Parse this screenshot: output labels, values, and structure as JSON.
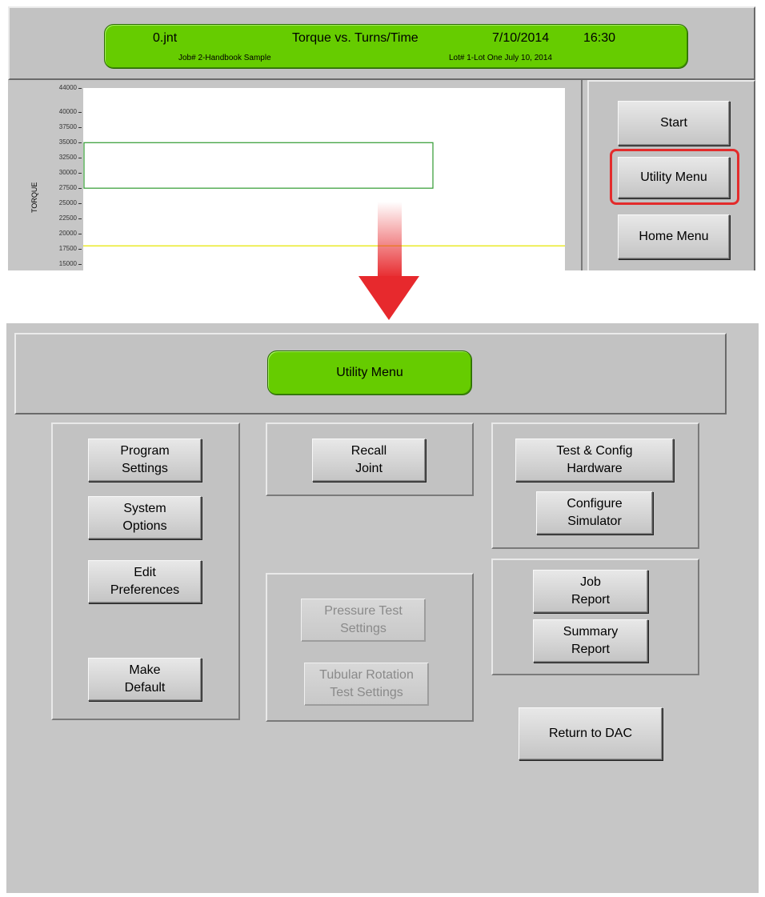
{
  "top_screen": {
    "header": {
      "file": "0.jnt",
      "title": "Torque vs. Turns/Time",
      "date": "7/10/2014",
      "time": "16:30",
      "job": "Job# 2-Handbook Sample",
      "lot": "Lot# 1-Lot One July 10, 2014",
      "color": "#66cc00"
    },
    "buttons": {
      "start": "Start",
      "utility_menu": "Utility Menu",
      "home_menu": "Home Menu"
    },
    "highlight_color": "#e32b2b",
    "chart_data": {
      "type": "line",
      "ylabel": "TORQUE",
      "y_ticks": [
        "44000",
        "40000",
        "37500",
        "35000",
        "32500",
        "30000",
        "27500",
        "25000",
        "22500",
        "20000",
        "17500",
        "15000"
      ],
      "tick_values": [
        44000,
        40000,
        37500,
        35000,
        32500,
        30000,
        27500,
        25000,
        22500,
        20000,
        17500,
        15000
      ],
      "target_box": {
        "y_min": 27500,
        "y_max": 35000,
        "color": "#2e9a2e"
      },
      "reference_line": {
        "y": 18000,
        "color": "#e6e600"
      }
    }
  },
  "arrow": {
    "icon": "down-arrow-icon",
    "color": "#e7292d"
  },
  "bottom_screen": {
    "header_title": "Utility Menu",
    "left_panel": {
      "program_settings": "Program\nSettings",
      "system_options": "System\nOptions",
      "edit_preferences": "Edit\nPreferences",
      "make_default": "Make\nDefault"
    },
    "middle_panel": {
      "recall_joint": "Recall\nJoint",
      "pressure_test_settings": "Pressure Test\nSettings",
      "tubular_rotation_test_settings": "Tubular Rotation\nTest Settings"
    },
    "right_panel": {
      "test_config_hardware": "Test & Config\nHardware",
      "configure_simulator": "Configure\nSimulator",
      "job_report": "Job\nReport",
      "summary_report": "Summary\nReport",
      "return_to_dac": "Return to DAC"
    }
  }
}
